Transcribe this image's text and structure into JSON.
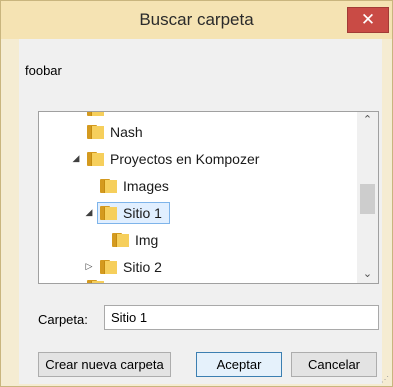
{
  "window": {
    "title": "Buscar carpeta",
    "close_symbol": "✕"
  },
  "dialog": {
    "description": "foobar"
  },
  "tree": {
    "items": [
      {
        "label": "Nash",
        "expander": "",
        "level": 1
      },
      {
        "label": "Proyectos en Kompozer",
        "expander": "◢",
        "level": 1
      },
      {
        "label": "Images",
        "expander": "",
        "level": 2
      },
      {
        "label": "Sitio 1",
        "expander": "◢",
        "level": 2,
        "selected": true
      },
      {
        "label": "Img",
        "expander": "",
        "level": 3
      },
      {
        "label": "Sitio 2",
        "expander": "▷",
        "level": 2
      }
    ],
    "scroll_up_symbol": "⌃",
    "scroll_down_symbol": "⌄"
  },
  "folder_field": {
    "label": "Carpeta:",
    "value": "Sitio 1"
  },
  "buttons": {
    "new_folder": "Crear nueva carpeta",
    "accept": "Aceptar",
    "cancel": "Cancelar"
  },
  "colors": {
    "title_bar": "#f5e3b3",
    "close_button": "#c94b45",
    "folder_icon": "#f6cf5c",
    "selection": "#e1efff"
  }
}
